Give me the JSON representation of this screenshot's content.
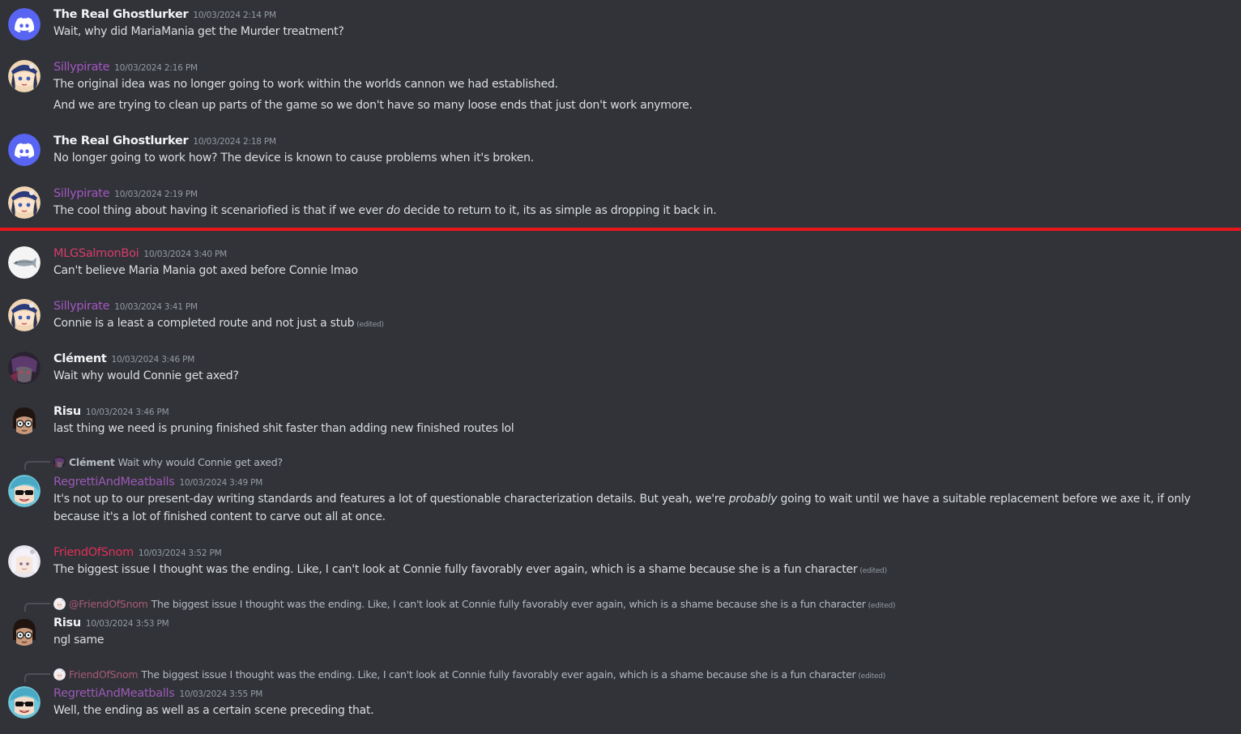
{
  "colors": {
    "background": "#313338",
    "divider": "#e5171c",
    "text": "#dbdee1",
    "timestamp": "#949ba4",
    "discord_blurple": "#5865f2"
  },
  "messages": [
    {
      "author": "The Real Ghostlurker",
      "timestamp": "10/03/2024 2:14 PM",
      "avatar_icon": "discord-logo-icon",
      "lines": [
        "Wait, why did MariaMania get the Murder treatment?"
      ]
    },
    {
      "author": "Sillypirate",
      "timestamp": "10/03/2024 2:16 PM",
      "avatar_icon": "anime-pirate-avatar",
      "lines": [
        "The original idea was no longer going to work within the worlds cannon we had established.",
        "And we are trying to clean up parts of the game so we don't have so many loose ends that just don't work anymore."
      ]
    },
    {
      "author": "The Real Ghostlurker",
      "timestamp": "10/03/2024 2:18 PM",
      "avatar_icon": "discord-logo-icon",
      "lines": [
        "No longer going to work how? The device is known to cause problems when it's broken."
      ]
    },
    {
      "author": "Sillypirate",
      "timestamp": "10/03/2024 2:19 PM",
      "avatar_icon": "anime-pirate-avatar",
      "line_parts": [
        "The cool thing about having it scenariofied is that if we ever ",
        "do",
        " decide to return to it, its as simple as dropping it back in."
      ]
    },
    {
      "author": "MLGSalmonBoi",
      "timestamp": "10/03/2024 3:40 PM",
      "avatar_icon": "salmon-fish-avatar",
      "lines": [
        "Can't believe Maria Mania got axed before Connie lmao"
      ]
    },
    {
      "author": "Sillypirate",
      "timestamp": "10/03/2024 3:41 PM",
      "avatar_icon": "anime-pirate-avatar",
      "lines": [
        "Connie is a least a completed route and not just a stub"
      ],
      "edited": "(edited)"
    },
    {
      "author": "Clément",
      "timestamp": "10/03/2024 3:46 PM",
      "avatar_icon": "dark-character-avatar",
      "lines": [
        "Wait why would Connie get axed?"
      ]
    },
    {
      "author": "Risu",
      "timestamp": "10/03/2024 3:46 PM",
      "avatar_icon": "glasses-character-avatar",
      "lines": [
        "last thing we need is pruning finished shit faster than adding new finished routes lol"
      ]
    },
    {
      "author": "RegrettiAndMeatballs",
      "timestamp": "10/03/2024 3:49 PM",
      "avatar_icon": "sunglasses-character-avatar",
      "reply": {
        "author": "Clément",
        "text": "Wait why would Connie get axed?"
      },
      "line_parts": [
        "It's not up to our present-day writing standards and features a lot of questionable characterization details. But yeah, we're ",
        "probably",
        " going to wait until we have a suitable replacement before we axe it, if only because it's a lot of finished content to carve out all at once."
      ]
    },
    {
      "author": "FriendOfSnom",
      "timestamp": "10/03/2024 3:52 PM",
      "avatar_icon": "white-hair-character-avatar",
      "lines": [
        "The biggest issue I thought was the ending. Like, I can't look at Connie fully favorably ever again, which is a shame because she is a fun character"
      ],
      "edited": "(edited)"
    },
    {
      "author": "Risu",
      "timestamp": "10/03/2024 3:53 PM",
      "avatar_icon": "glasses-character-avatar",
      "reply": {
        "author": "@FriendOfSnom",
        "text": "The biggest issue I thought was the ending. Like, I can't look at Connie fully favorably ever again, which is a shame because she is a fun character",
        "edited": "(edited)"
      },
      "lines": [
        "ngl same"
      ]
    },
    {
      "author": "RegrettiAndMeatballs",
      "timestamp": "10/03/2024 3:55 PM",
      "avatar_icon": "sunglasses-character-avatar",
      "reply": {
        "author": "FriendOfSnom",
        "text": "The biggest issue I thought was the ending. Like, I can't look at Connie fully favorably ever again, which is a shame because she is a fun character",
        "edited": "(edited)"
      },
      "lines": [
        "Well, the ending as well as a certain scene preceding that."
      ]
    }
  ]
}
